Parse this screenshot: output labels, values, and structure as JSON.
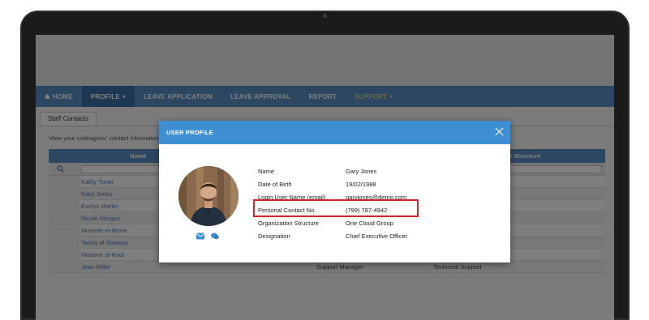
{
  "nav": {
    "home": "HOME",
    "items": [
      "PROFILE",
      "LEAVE APPLICATION",
      "LEAVE APPROVAL",
      "REPORT",
      "SUPPORT"
    ]
  },
  "page": {
    "tab": "Staff Contacts",
    "intro": "View your colleagues' contact information",
    "columns": {
      "name": "Name",
      "org": "ion Structure"
    }
  },
  "staff": [
    {
      "name": "Kathy Tuner",
      "designation": "",
      "org": ""
    },
    {
      "name": "Gary Jones",
      "designation": "",
      "org": ""
    },
    {
      "name": "Evelyn Martin",
      "designation": "",
      "org": ""
    },
    {
      "name": "Nicole Morgan",
      "designation": "",
      "org": ""
    },
    {
      "name": "Muneeb el-Mona",
      "designation": "",
      "org": ""
    },
    {
      "name": "Taariq al-Sawaya",
      "designation": "",
      "org": ""
    },
    {
      "name": "Mastoor al-Radi",
      "designation": "",
      "org": ""
    },
    {
      "name": "Jean Miller",
      "designation": "Support Manager",
      "org": "Technical Support"
    }
  ],
  "modal": {
    "title": "USER PROFILE",
    "fields": [
      {
        "label": "Name",
        "value": "Gary Jones"
      },
      {
        "label": "Date of Birth",
        "value": "19/02/1988"
      },
      {
        "label": "Login User Name (email)",
        "value": "garyjones@demo.com"
      },
      {
        "label": "Personal Contact No.",
        "value": "(799) 787-4942"
      },
      {
        "label": "Organization Structure",
        "value": "One Cloud Group"
      },
      {
        "label": "Designation",
        "value": "Chief Executive Officer"
      }
    ],
    "icons": [
      "envelope-icon",
      "chat-icon"
    ]
  },
  "colors": {
    "navbar": "#5a8fc7",
    "modal_header": "#3d8fd1",
    "highlight": "#d3232a",
    "link": "#4a78b4"
  }
}
